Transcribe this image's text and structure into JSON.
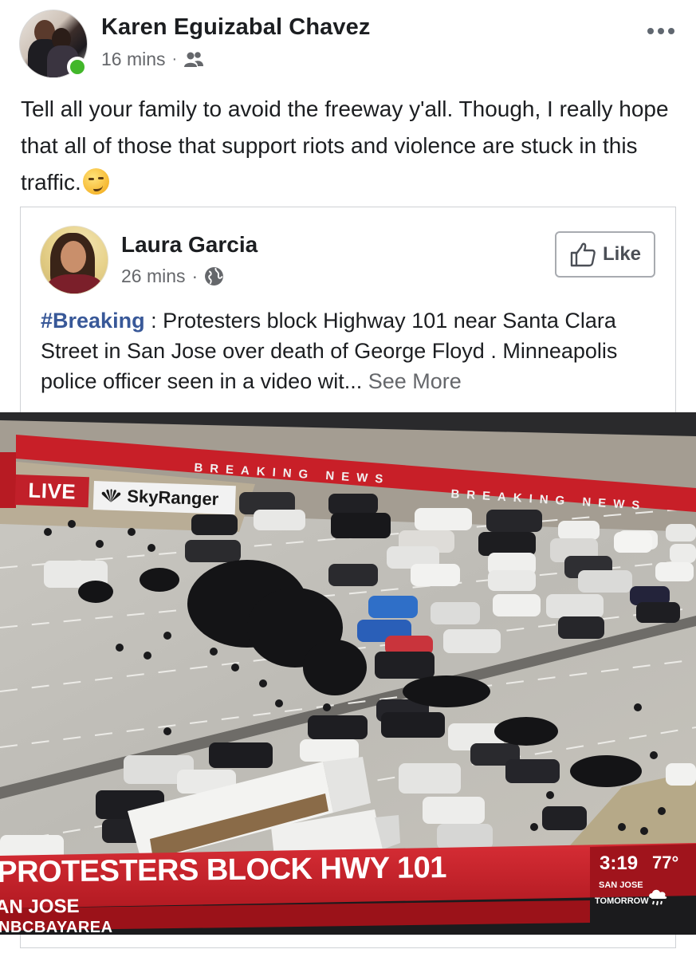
{
  "post": {
    "author": "Karen Eguizabal Chavez",
    "time": "16 mins",
    "separator": "·",
    "audience_icon": "friends-icon",
    "more_icon": "more-horizontal-icon",
    "text": "Tell all your family to avoid the freeway y'all. Though, I really hope that all of those that support riots and violence are stuck in this traffic.",
    "emoji": "smirking-face"
  },
  "shared": {
    "author": "Laura Garcia",
    "time": "26 mins",
    "separator": "·",
    "audience_icon": "globe-icon",
    "like_label": "Like",
    "hashtag": "#Breaking",
    "text": " : Protesters block Highway 101 near Santa Clara Street in San Jose over death of George Floyd . Minneapolis police officer seen in a video wit...",
    "see_more": "See More"
  },
  "broadcast": {
    "live": "LIVE",
    "camera": "SkyRanger",
    "ribbon_1": "BREAKING NEWS",
    "ribbon_2": "BREAKING NEWS",
    "headline": "PROTESTERS BLOCK HWY 101",
    "location": "AN JOSE",
    "channel": "NBCBAYAREA",
    "time": "3:19",
    "temperature": "77°",
    "city": "SAN JOSE",
    "forecast": "TOMORROW",
    "colors": {
      "banner_red": "#c1202a",
      "hashtag_blue": "#385898",
      "online_green": "#42b72a"
    }
  }
}
